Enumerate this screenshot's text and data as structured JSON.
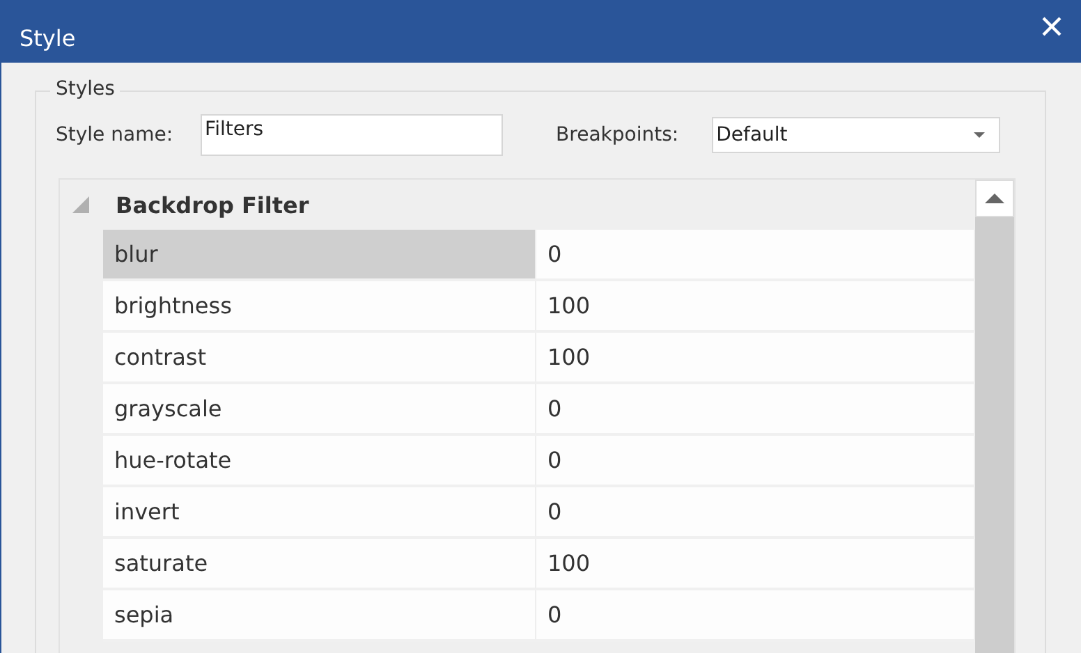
{
  "window": {
    "title": "Style"
  },
  "group": {
    "legend": "Styles"
  },
  "style_name": {
    "label": "Style name:",
    "value": "Filters"
  },
  "breakpoints": {
    "label": "Breakpoints:",
    "value": "Default"
  },
  "section": {
    "title": "Backdrop Filter",
    "expanded": true,
    "rows": [
      {
        "name": "blur",
        "value": "0",
        "selected": true
      },
      {
        "name": "brightness",
        "value": "100",
        "selected": false
      },
      {
        "name": "contrast",
        "value": "100",
        "selected": false
      },
      {
        "name": "grayscale",
        "value": "0",
        "selected": false
      },
      {
        "name": "hue-rotate",
        "value": "0",
        "selected": false
      },
      {
        "name": "invert",
        "value": "0",
        "selected": false
      },
      {
        "name": "saturate",
        "value": "100",
        "selected": false
      },
      {
        "name": "sepia",
        "value": "0",
        "selected": false
      }
    ]
  }
}
